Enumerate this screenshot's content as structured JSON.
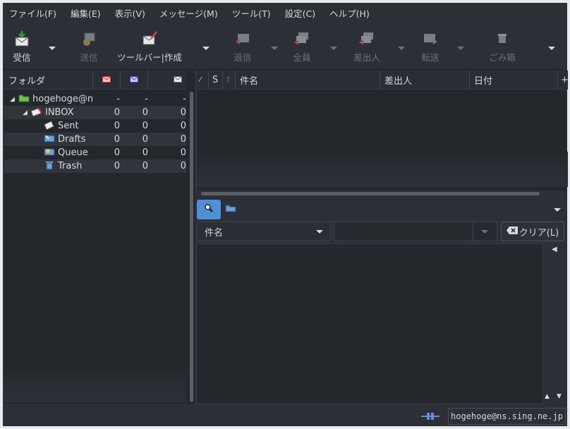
{
  "menu": [
    "ファイル(F)",
    "編集(E)",
    "表示(V)",
    "メッセージ(M)",
    "ツール(T)",
    "設定(C)",
    "ヘルプ(H)"
  ],
  "toolbar": {
    "receive": "受信",
    "send": "送信",
    "compose": "ツールバー|作成",
    "reply": "返信",
    "reply_all": "全員",
    "reply_sender": "差出人",
    "forward": "転送",
    "trash": "ごみ箱"
  },
  "folder_pane": {
    "header": "フォルダ",
    "folders": [
      {
        "name": "hogehoge@ns",
        "unread": "-",
        "new": "-",
        "total": "-"
      },
      {
        "name": "INBOX",
        "unread": "0",
        "new": "0",
        "total": "0"
      },
      {
        "name": "Sent",
        "unread": "0",
        "new": "0",
        "total": "0"
      },
      {
        "name": "Drafts",
        "unread": "0",
        "new": "0",
        "total": "0"
      },
      {
        "name": "Queue",
        "unread": "0",
        "new": "0",
        "total": "0"
      },
      {
        "name": "Trash",
        "unread": "0",
        "new": "0",
        "total": "0"
      }
    ]
  },
  "message_list": {
    "col_s": "S",
    "col_subject": "件名",
    "col_from": "差出人",
    "col_date": "日付"
  },
  "search": {
    "field": "件名",
    "value": "",
    "clear": "クリア(L)"
  },
  "status": {
    "account": "hogehoge@ns.sing.ne.jp"
  },
  "colors": {
    "background": "#2c2f35",
    "pane": "#24272c",
    "accent": "#4f8fd6"
  }
}
